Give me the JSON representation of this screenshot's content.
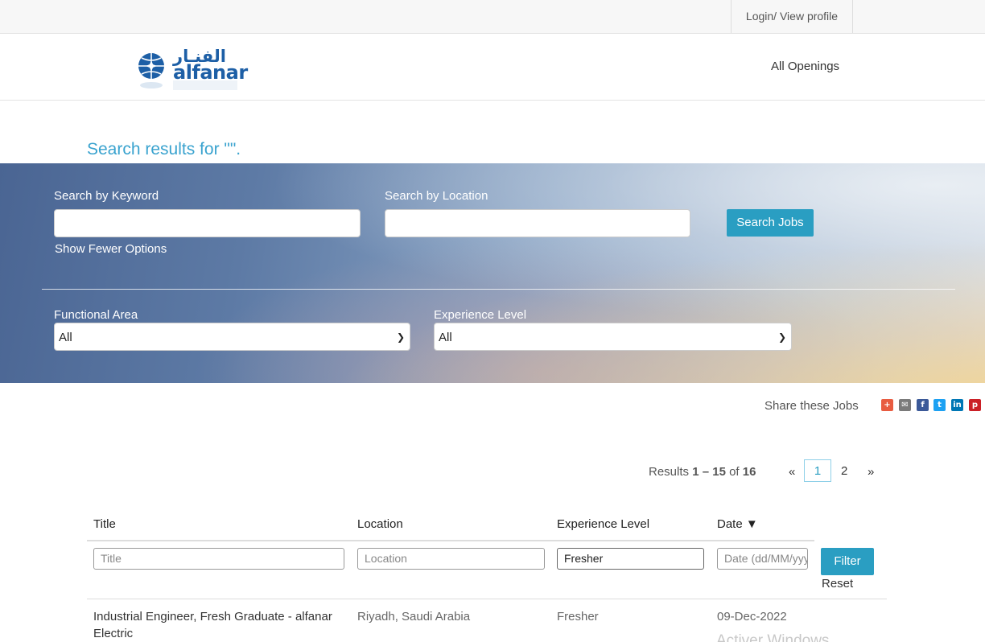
{
  "topbar": {
    "login_label": "Login/ View profile"
  },
  "header": {
    "logo_arabic": "الفنـار",
    "logo_text": "alfanar",
    "nav_all_openings": "All Openings"
  },
  "results_heading": "Search results for \"\".",
  "search": {
    "keyword_label": "Search by Keyword",
    "keyword_value": "",
    "location_label": "Search by Location",
    "location_value": "",
    "search_button": "Search Jobs",
    "show_fewer": "Show Fewer Options",
    "functional_area_label": "Functional Area",
    "functional_area_value": "All",
    "experience_label": "Experience Level",
    "experience_value": "All"
  },
  "share": {
    "label": "Share these Jobs",
    "icons": [
      "plus-share-icon",
      "email-icon",
      "facebook-icon",
      "twitter-icon",
      "linkedin-icon",
      "pinterest-icon"
    ],
    "colors": {
      "plus": "#e85c41",
      "email": "#7a7a7a",
      "facebook": "#3b5998",
      "twitter": "#1da1f2",
      "linkedin": "#0077b5",
      "pinterest": "#cb2027"
    }
  },
  "pagination": {
    "results_prefix": "Results",
    "range": "1 – 15",
    "of": "of",
    "total": "16",
    "prev": "«",
    "current": "1",
    "page2": "2",
    "next": "»"
  },
  "table": {
    "headers": {
      "title": "Title",
      "location": "Location",
      "experience": "Experience Level",
      "date": "Date ▼"
    },
    "filters": {
      "title_placeholder": "Title",
      "location_placeholder": "Location",
      "experience_value": "Fresher",
      "date_placeholder": "Date (dd/MM/yyyy)",
      "filter_button": "Filter",
      "reset_link": "Reset"
    },
    "rows": [
      {
        "title": "Industrial Engineer, Fresh Graduate - alfanar Electric",
        "location": "Riyadh, Saudi Arabia",
        "experience": "Fresher",
        "date": "09-Dec-2022"
      }
    ]
  },
  "watermark": "Activer Windows",
  "colors": {
    "accent": "#2a9ec2",
    "heading": "#3aa3cf",
    "logo_blue": "#1d5fa6"
  }
}
